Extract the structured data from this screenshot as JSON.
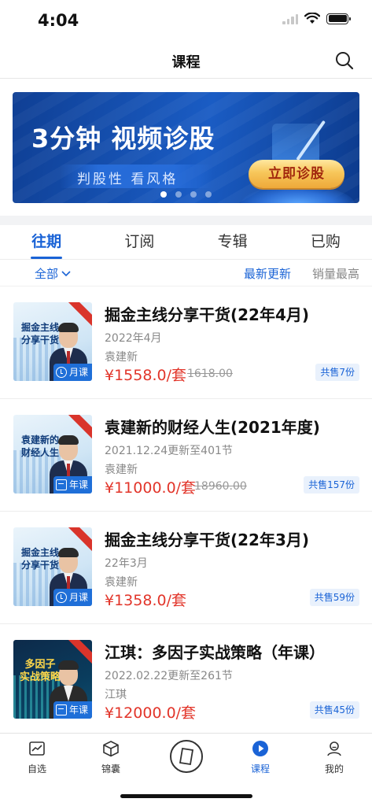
{
  "status_bar": {
    "time": "4:04"
  },
  "nav": {
    "title": "课程",
    "search_icon": "search-icon"
  },
  "banner": {
    "title": "3分钟 视频诊股",
    "subtitle": "判股性  看风格",
    "cta": "立即诊股",
    "pages": 4,
    "active_page": 0
  },
  "tabs": [
    {
      "label": "往期",
      "active": true
    },
    {
      "label": "订阅",
      "active": false
    },
    {
      "label": "专辑",
      "active": false
    },
    {
      "label": "已购",
      "active": false
    }
  ],
  "filter": {
    "all_label": "全部",
    "sort_latest": "最新更新",
    "sort_sales": "销量最高"
  },
  "courses": [
    {
      "thumb_text": "掘金主线\n分享干货",
      "title": "掘金主线分享干货(22年4月)",
      "date": "2022年4月",
      "author": "袁建新",
      "price": "¥1558.0/套",
      "original_price": "1618.00",
      "sold": "共售7份",
      "badge": "月课",
      "badge_icon": "clock-icon",
      "theme": "light"
    },
    {
      "thumb_text": "袁建新的\n财经人生",
      "title": "袁建新的财经人生(2021年度)",
      "date": "2021.12.24更新至401节",
      "author": "袁建新",
      "price": "¥11000.0/套",
      "original_price": "18960.00",
      "sold": "共售157份",
      "badge": "年课",
      "badge_icon": "calendar-icon",
      "theme": "light"
    },
    {
      "thumb_text": "掘金主线\n分享干货",
      "title": "掘金主线分享干货(22年3月)",
      "date": "22年3月",
      "author": "袁建新",
      "price": "¥1358.0/套",
      "original_price": "",
      "sold": "共售59份",
      "badge": "月课",
      "badge_icon": "clock-icon",
      "theme": "light"
    },
    {
      "thumb_text": "多因子\n实战策略",
      "title": "江琪：多因子实战策略（年课）",
      "date": "2022.02.22更新至261节",
      "author": "江琪",
      "price": "¥12000.0/套",
      "original_price": "",
      "sold": "共售45份",
      "badge": "年课",
      "badge_icon": "calendar-icon",
      "theme": "dark"
    }
  ],
  "tab_bar": [
    {
      "label": "自选",
      "icon": "chart-icon",
      "active": false
    },
    {
      "label": "锦囊",
      "icon": "box-icon",
      "active": false
    },
    {
      "label": "",
      "icon": "compass-icon",
      "active": false
    },
    {
      "label": "课程",
      "icon": "play-icon",
      "active": true
    },
    {
      "label": "我的",
      "icon": "user-icon",
      "active": false
    }
  ],
  "colors": {
    "accent": "#1a63d6",
    "price": "#e2352a",
    "muted": "#888888"
  }
}
